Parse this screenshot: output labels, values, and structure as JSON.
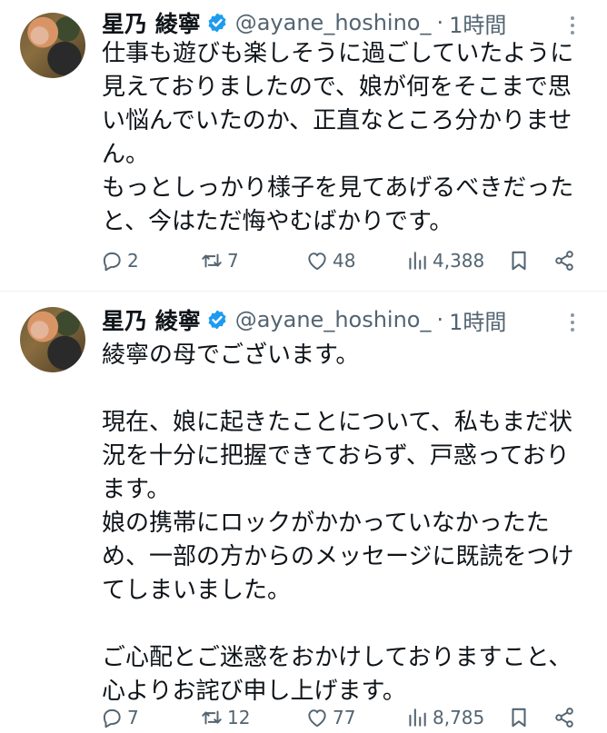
{
  "tweets": [
    {
      "author": {
        "name": "星乃 綾寧",
        "handle": "@ayane_hoshino_",
        "verified": true
      },
      "separator": "·",
      "time": "1時間",
      "lines": [
        "仕事も遊びも楽しそうに過ごしていたように",
        "見えておりましたので、娘が何をそこまで思",
        "い悩んでいたのか、正直なところ分かりませ",
        "ん。",
        "もっとしっかり様子を見てあげるべきだった",
        "と、今はただ悔やむばかりです。"
      ],
      "stats": {
        "replies": "2",
        "reposts": "7",
        "likes": "48",
        "views": "4,388"
      }
    },
    {
      "author": {
        "name": "星乃 綾寧",
        "handle": "@ayane_hoshino_",
        "verified": true
      },
      "separator": "·",
      "time": "1時間",
      "lines": [
        "綾寧の母でございます。",
        "",
        "現在、娘に起きたことについて、私もまだ状",
        "況を十分に把握できておらず、戸惑っており",
        "ます。",
        "娘の携帯にロックがかかっていなかったた",
        "め、一部の方からのメッセージに既読をつけ",
        "てしまいました。",
        "",
        "ご心配とご迷惑をおかけしておりますこと、",
        "心よりお詫び申し上げます。"
      ],
      "stats": {
        "replies": "7",
        "reposts": "12",
        "likes": "77",
        "views": "8,785"
      }
    }
  ],
  "colors": {
    "verified": "#1d9bf0",
    "muted": "#536471",
    "text": "#0f1419"
  },
  "icons": [
    "reply-icon",
    "repost-icon",
    "like-icon",
    "views-icon",
    "bookmark-icon",
    "share-icon",
    "verified-badge-icon",
    "more-icon"
  ]
}
